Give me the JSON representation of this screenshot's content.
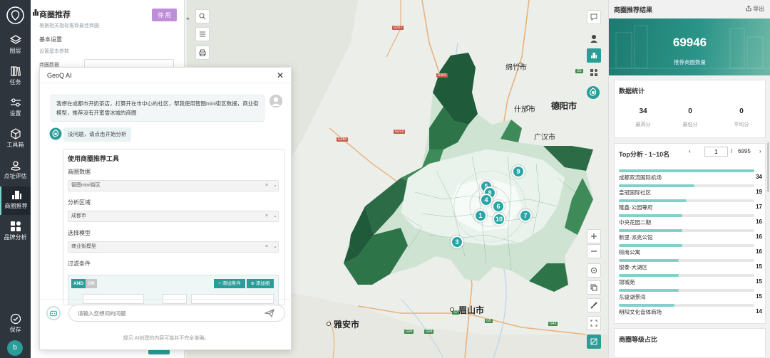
{
  "nav": {
    "items": [
      {
        "label": "图层",
        "icon": "layers-icon"
      },
      {
        "label": "任务",
        "icon": "books-icon"
      },
      {
        "label": "设置",
        "icon": "sliders-icon"
      },
      {
        "label": "工具箱",
        "icon": "cube-icon"
      },
      {
        "label": "点址评估",
        "icon": "location-pin-icon"
      },
      {
        "label": "商圈推荐",
        "icon": "buildings-icon",
        "active": true
      },
      {
        "label": "品牌分析",
        "icon": "grid-icon"
      }
    ],
    "save_label": "保存",
    "avatar_letter": "b"
  },
  "tool_panel": {
    "title": "商圈推荐",
    "subtitle": "根据相关指标推荐最佳商圈",
    "stop_label": "停 用",
    "section": "基本设置",
    "section_sub": "设置基本参数",
    "field_label": "商圈数据"
  },
  "chat": {
    "title": "GeoQ AI",
    "close_icon": "✕",
    "user_message": "我想在成都市开奶茶店，打算开在市中心的社区，帮我使用智图mini街区数据，商业街模型，推荐没有开蜜雪冰城的商圈",
    "ai_reply": "没问题，请点击开始分析",
    "tool_title": "使用商圈推荐工具",
    "fields": [
      {
        "label": "商圈数据",
        "value": "智图mini街区"
      },
      {
        "label": "分析区域",
        "value": "成都市"
      },
      {
        "label": "选择模型",
        "value": "商业街模型"
      }
    ],
    "filter_label": "过滤条件",
    "and_label": "AND",
    "or_label": "OR",
    "add_condition": "+ 添加条件",
    "add_group": "⊕ 添加组",
    "input_placeholder": "请输入您想问的问题",
    "hint": "提示:AI创建的内容可能并不完全准确。"
  },
  "map": {
    "cities": [
      {
        "name": "绵竹市"
      },
      {
        "name": "什邡市"
      },
      {
        "name": "德阳市"
      },
      {
        "name": "广汉市"
      },
      {
        "name": "眉山市"
      },
      {
        "name": "雅安市"
      }
    ],
    "road_badges": [
      "G317",
      "S303",
      "G350",
      "G213",
      "G5",
      "G5",
      "S7",
      "G5",
      "G93",
      "G93",
      "G42"
    ],
    "markers": [
      "9",
      "5",
      "8",
      "4",
      "6",
      "1",
      "10",
      "7",
      "3"
    ]
  },
  "results": {
    "title": "商圈推荐结果",
    "export_label": "导出",
    "kpi_value": "69946",
    "kpi_label": "推荐商圈数量",
    "stats_title": "数据统计",
    "stats": [
      {
        "value": "34",
        "label": "最高分"
      },
      {
        "value": "0",
        "label": "最低分"
      },
      {
        "value": "0",
        "label": "平均分"
      }
    ],
    "top_title": "Top分析 - 1~10名",
    "page": "1",
    "page_total": "6995",
    "ranking": [
      {
        "name": "成都双流国际机场",
        "score": 34,
        "fill": 1.0
      },
      {
        "name": "皇冠国际社区",
        "score": 19,
        "fill": 0.56
      },
      {
        "name": "隆鑫·公园尊府",
        "score": 17,
        "fill": 0.5
      },
      {
        "name": "中央花园二期",
        "score": 16,
        "fill": 0.47
      },
      {
        "name": "新里·派克公馆",
        "score": 16,
        "fill": 0.47
      },
      {
        "name": "棕南公寓",
        "score": 16,
        "fill": 0.47
      },
      {
        "name": "银泰·大湖区",
        "score": 15,
        "fill": 0.44
      },
      {
        "name": "锦城苑",
        "score": 15,
        "fill": 0.44
      },
      {
        "name": "东骏湖景湾",
        "score": 15,
        "fill": 0.44
      },
      {
        "name": "明阳文化音体商场",
        "score": 14,
        "fill": 0.41
      }
    ],
    "grade_title": "商圈等级占比"
  },
  "colors": {
    "accent": "#2a9d99",
    "nav_bg": "#2f353d",
    "stop_button": "#c08ed9",
    "polygon_dark": "#1f5a3b"
  }
}
